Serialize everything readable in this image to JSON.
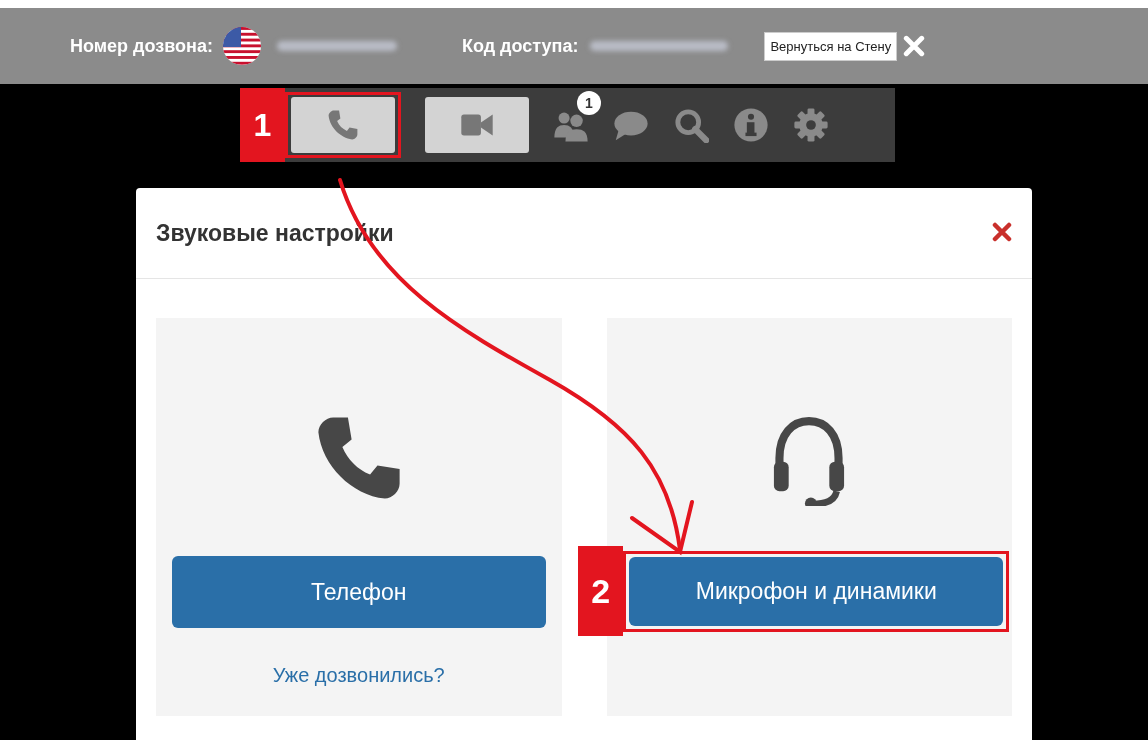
{
  "header": {
    "dial_in_label": "Номер дозвона:",
    "access_code_label": "Код доступа:",
    "back_button": "Вернуться на Стену"
  },
  "toolbar": {
    "items": [
      {
        "kind": "phone",
        "boxed": true,
        "callout": "1"
      },
      {
        "kind": "video",
        "boxed": true
      },
      {
        "kind": "people",
        "boxed": false,
        "badge": "1"
      },
      {
        "kind": "chat",
        "boxed": false
      },
      {
        "kind": "search",
        "boxed": false
      },
      {
        "kind": "info",
        "boxed": false
      },
      {
        "kind": "gear",
        "boxed": false
      }
    ]
  },
  "dialog": {
    "title": "Звуковые настройки",
    "options": [
      {
        "kind": "phone",
        "button": "Телефон",
        "link": "Уже дозвонились?"
      },
      {
        "kind": "headset",
        "button": "Микрофон и динамики",
        "callout": "2"
      }
    ]
  }
}
